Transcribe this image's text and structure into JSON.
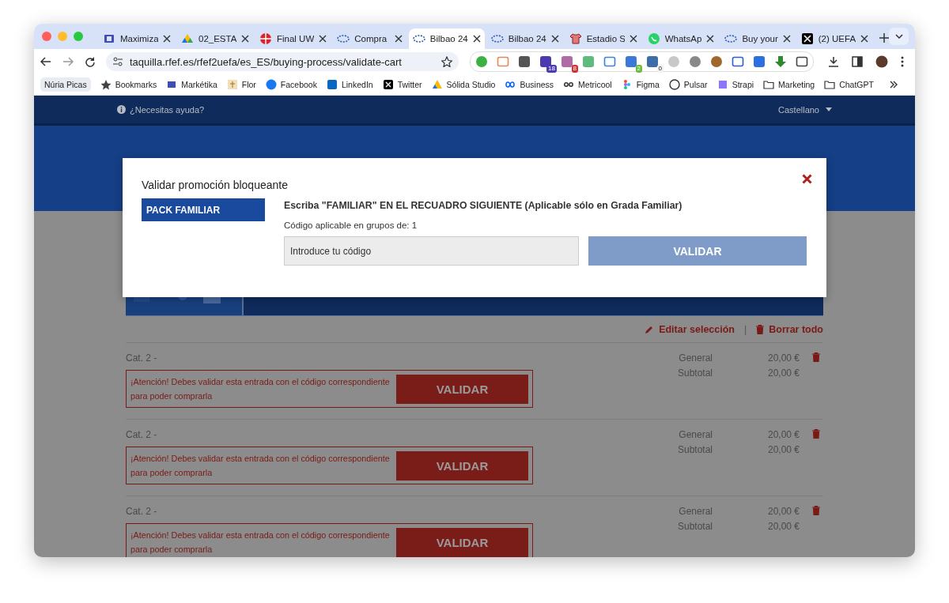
{
  "browser": {
    "tabs": [
      {
        "title": "Maximiza",
        "selected": false
      },
      {
        "title": "02_ESTA",
        "selected": false
      },
      {
        "title": "Final UW",
        "selected": false
      },
      {
        "title": "Compra",
        "selected": false
      },
      {
        "title": "Bilbao 24",
        "selected": true
      },
      {
        "title": "Bilbao 24",
        "selected": false
      },
      {
        "title": "Estadio S",
        "selected": false
      },
      {
        "title": "WhatsAp",
        "selected": false
      },
      {
        "title": "Buy your",
        "selected": false
      },
      {
        "title": "(2) UEFA",
        "selected": false
      }
    ],
    "address": "taquilla.rfef.es/rfef2uefa/es_ES/buying-process/validate-cart",
    "extension_badges": [
      "18",
      "8",
      "2",
      "0"
    ],
    "profile": "Núria Picas",
    "bookmarks": [
      "Bookmarks",
      "Markétika",
      "Flor",
      "Facebook",
      "LinkedIn",
      "Twitter",
      "Sólida Studio",
      "Business",
      "Metricool",
      "Figma",
      "Pulsar",
      "Strapi",
      "Marketing",
      "ChatGPT"
    ]
  },
  "page": {
    "help": "¿Necesitas ayuda?",
    "language": "Castellano",
    "cart": {
      "actions": [
        "Editar selección",
        "Borrar todo"
      ],
      "separator": "|",
      "items": [
        {
          "category": "Cat. 2 -",
          "warning": "¡Atención! Debes validar esta entrada con el código correspondiente para poder comprarla",
          "button": "VALIDAR",
          "lines": [
            {
              "label": "General",
              "price": "20,00 €"
            },
            {
              "label": "Subtotal",
              "price": "20,00 €"
            }
          ]
        },
        {
          "category": "Cat. 2 -",
          "warning": "¡Atención! Debes validar esta entrada con el código correspondiente para poder comprarla",
          "button": "VALIDAR",
          "lines": [
            {
              "label": "General",
              "price": "20,00 €"
            },
            {
              "label": "Subtotal",
              "price": "20,00 €"
            }
          ]
        },
        {
          "category": "Cat. 2 -",
          "warning": "¡Atención! Debes validar esta entrada con el código correspondiente para poder comprarla",
          "button": "VALIDAR",
          "lines": [
            {
              "label": "General",
              "price": "20,00 €"
            },
            {
              "label": "Subtotal",
              "price": "20,00 €"
            }
          ]
        }
      ]
    }
  },
  "modal": {
    "title": "Validar promoción bloqueante",
    "promos": [
      {
        "label": "PACK FAMILIAR",
        "selected": true
      }
    ],
    "instruction": "Escriba \"FAMILIAR\" EN EL RECUADRO SIGUIENTE (Aplicable sólo en Grada Familiar)",
    "note": "Código aplicable en grupos de: 1",
    "placeholder": "Introduce tu código",
    "button": {
      "label": "VALIDAR",
      "disabled": true
    }
  }
}
